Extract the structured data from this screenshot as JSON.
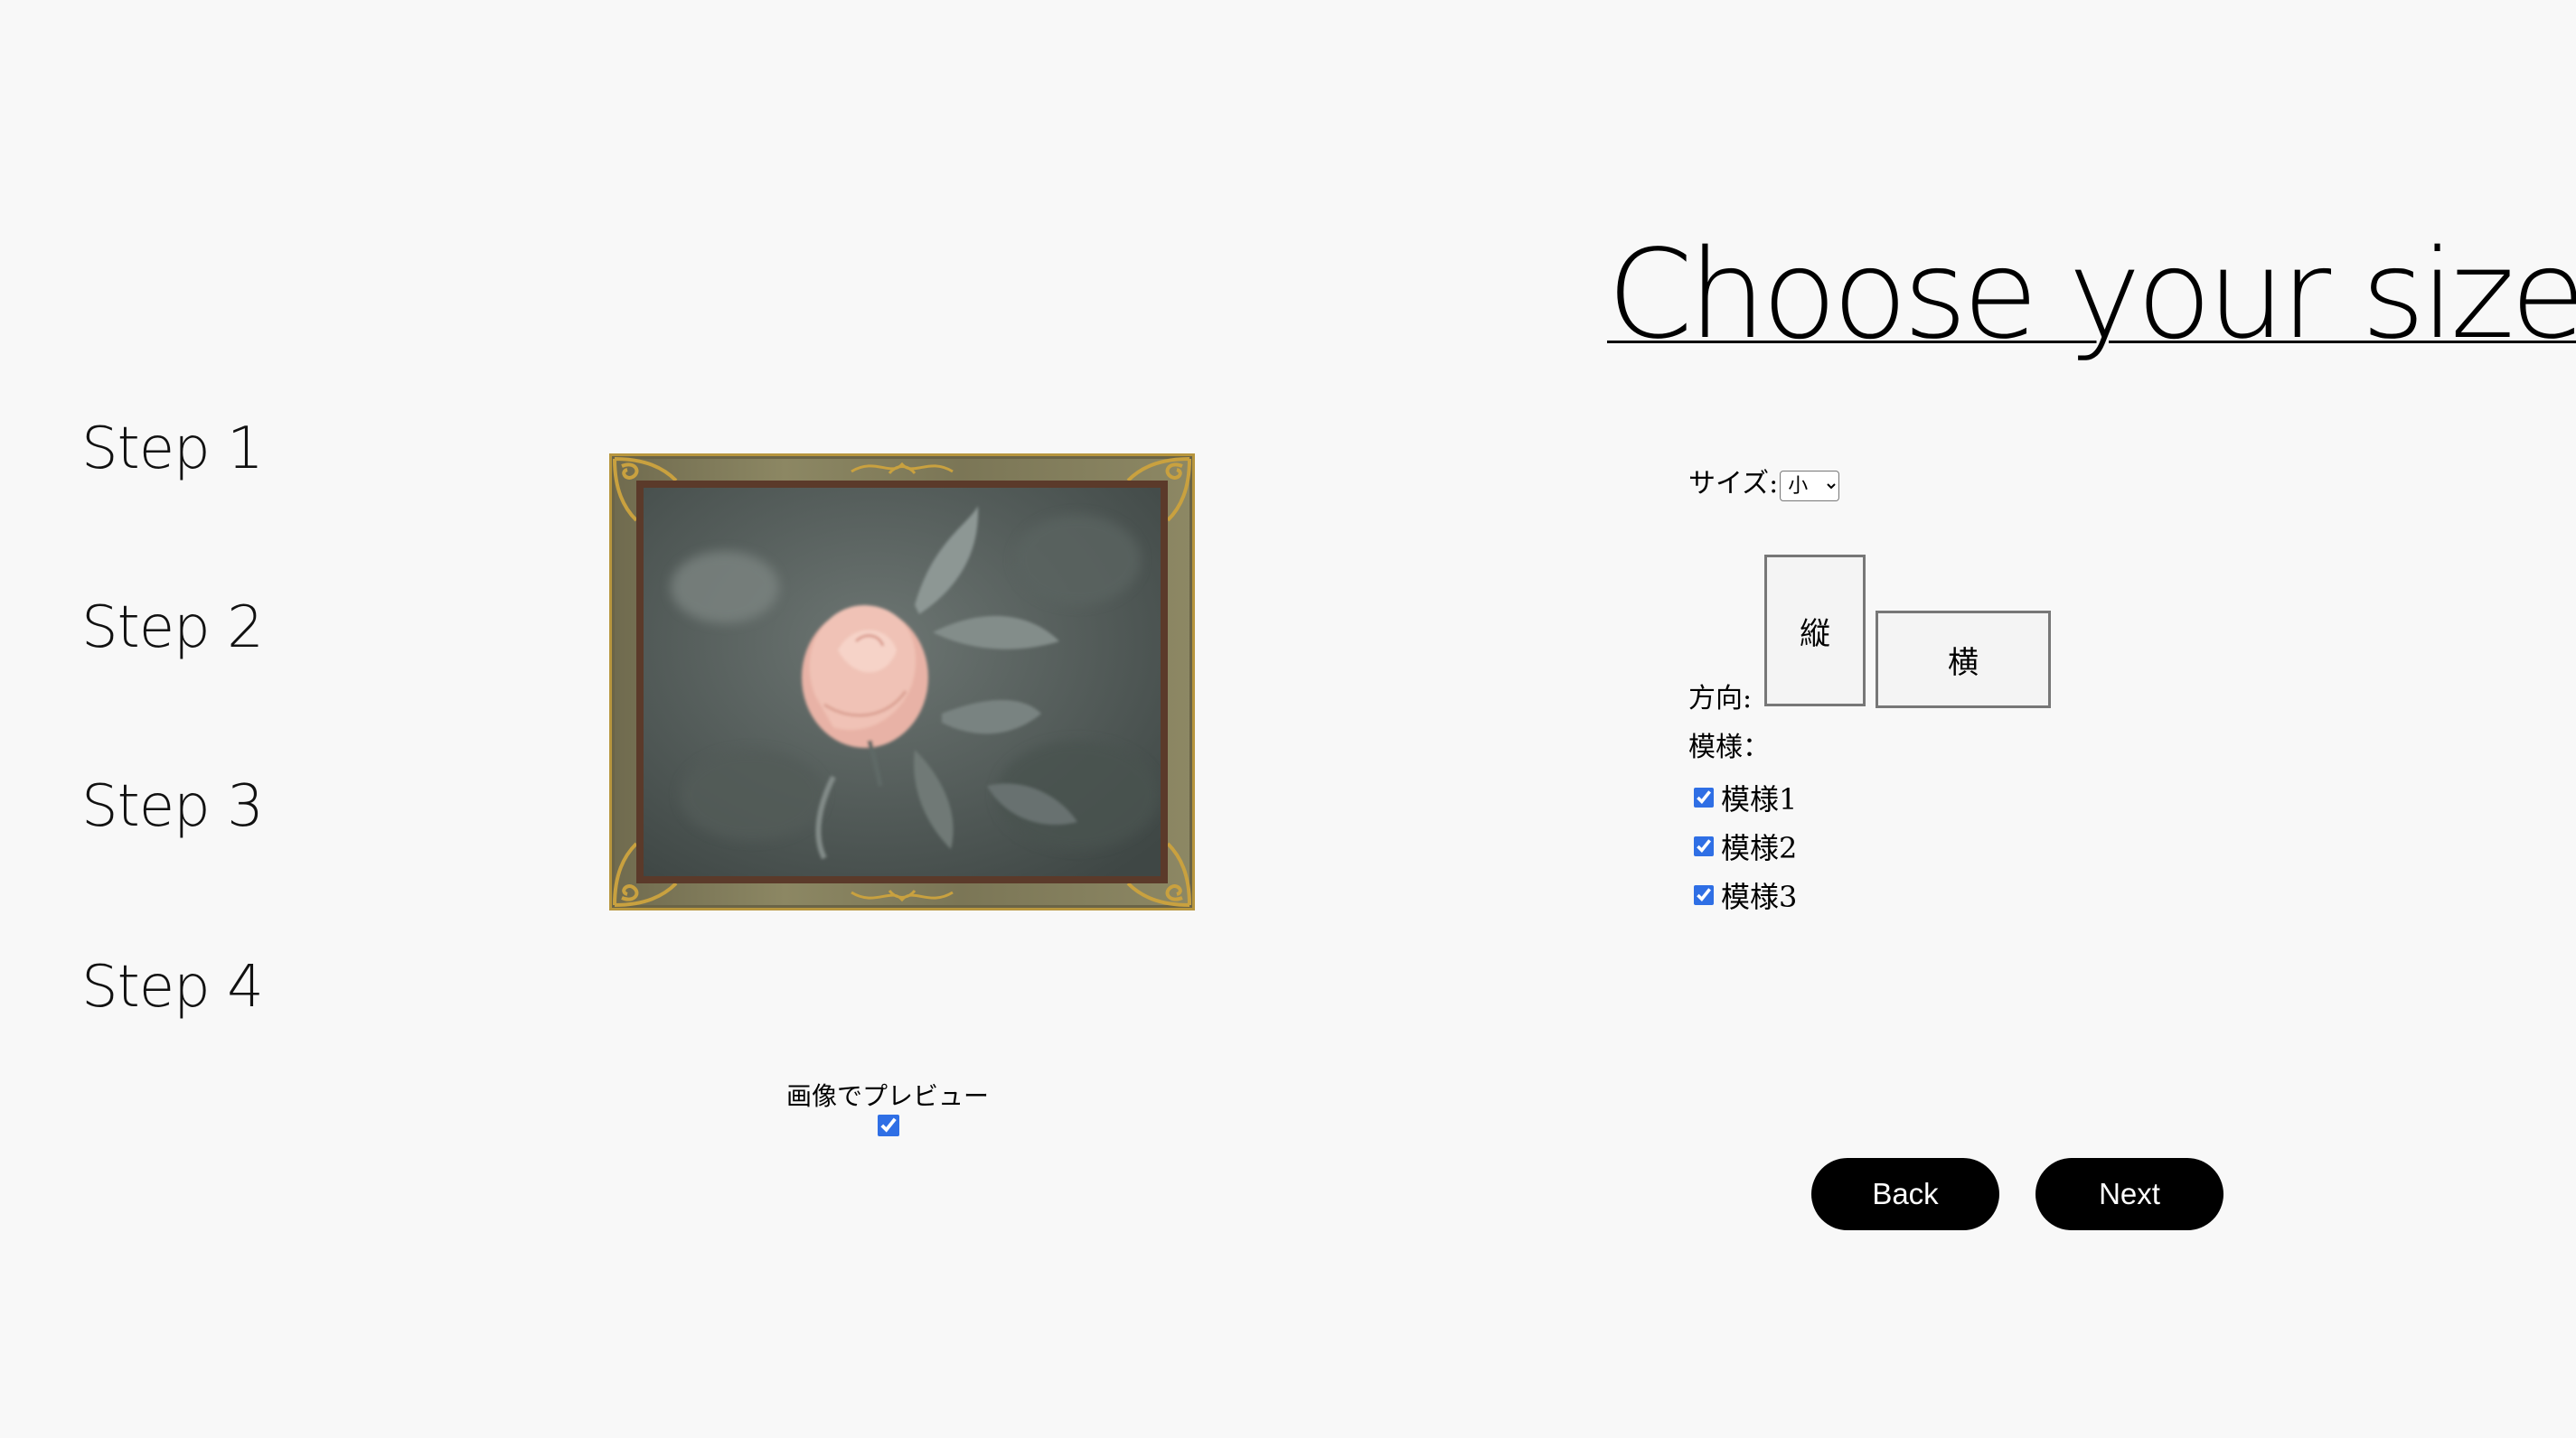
{
  "steps": [
    "Step 1",
    "Step 2",
    "Step 3",
    "Step 4"
  ],
  "preview": {
    "label": "画像でプレビュー",
    "checked": true
  },
  "title": "Choose your size",
  "size": {
    "label": "サイズ:",
    "selected": "小"
  },
  "direction": {
    "label": "方向:",
    "portrait": "縦",
    "landscape": "横"
  },
  "pattern": {
    "label": "模様：",
    "items": [
      {
        "label": "模様1",
        "checked": true
      },
      {
        "label": "模様2",
        "checked": true
      },
      {
        "label": "模様3",
        "checked": true
      }
    ]
  },
  "buttons": {
    "back": "Back",
    "next": "Next"
  },
  "colors": {
    "background": "#f8f8f8",
    "button": "#000000",
    "checkbox": "#2f6fe5",
    "frame_gold": "#c9a13f"
  },
  "icons": {
    "frame_ornaments": "gold-filigree",
    "select_arrow": "chevron-down"
  }
}
